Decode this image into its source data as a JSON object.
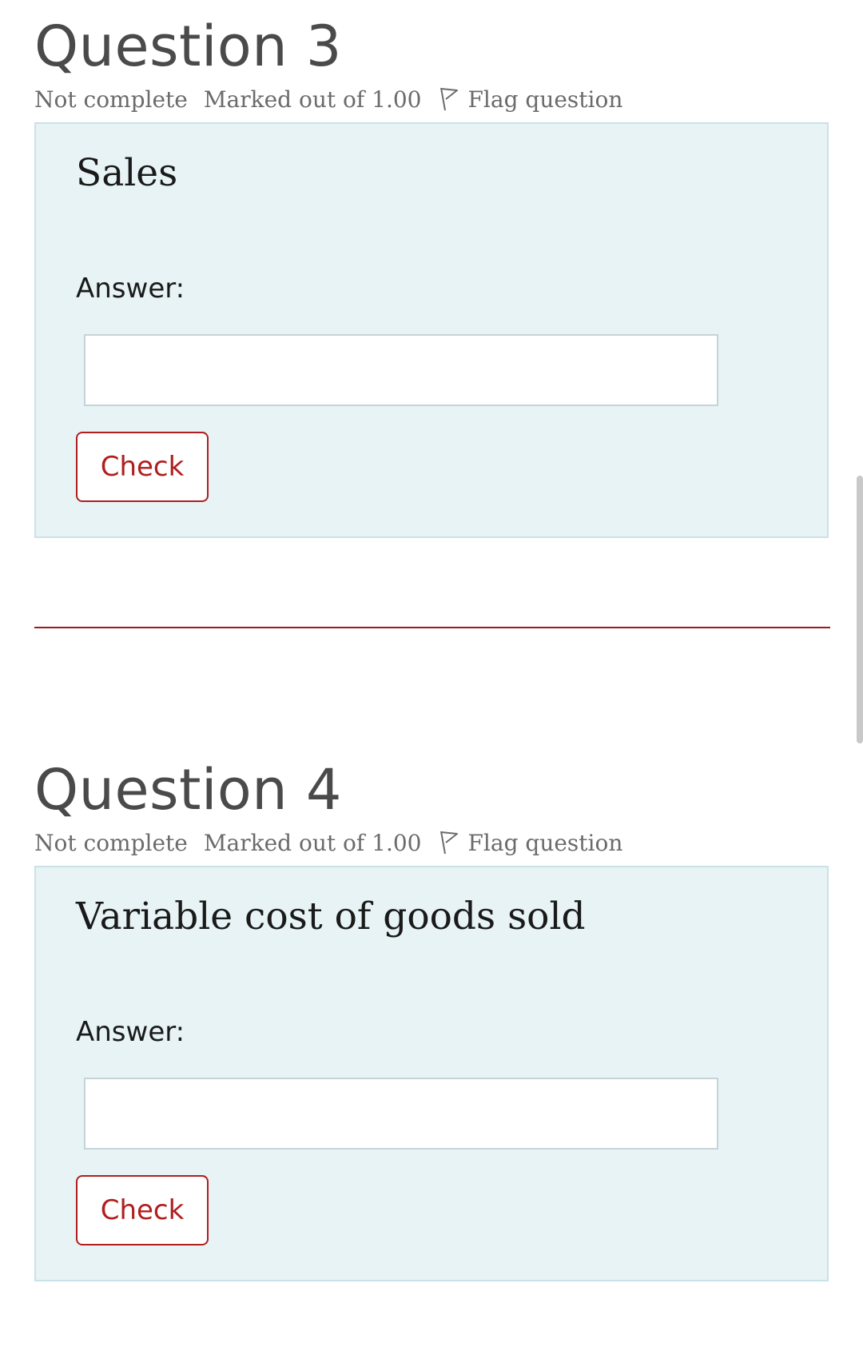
{
  "questions": [
    {
      "title": "Question 3",
      "status": "Not complete",
      "marks": "Marked out of 1.00",
      "flag_label": "Flag question",
      "question_text": "Sales",
      "answer_label": "Answer:",
      "answer_value": "",
      "check_label": "Check"
    },
    {
      "title": "Question 4",
      "status": "Not complete",
      "marks": "Marked out of 1.00",
      "flag_label": "Flag question",
      "question_text": "Variable cost of goods sold",
      "answer_label": "Answer:",
      "answer_value": "",
      "check_label": "Check"
    }
  ],
  "colors": {
    "box_background": "#e7f3f5",
    "box_border": "#c8e2ea",
    "accent": "#b01e1e",
    "divider": "#9b1c1c",
    "meta_text": "#6b6b6b",
    "title_text": "#4a4a4a"
  },
  "icons": {
    "flag": "flag-icon"
  }
}
